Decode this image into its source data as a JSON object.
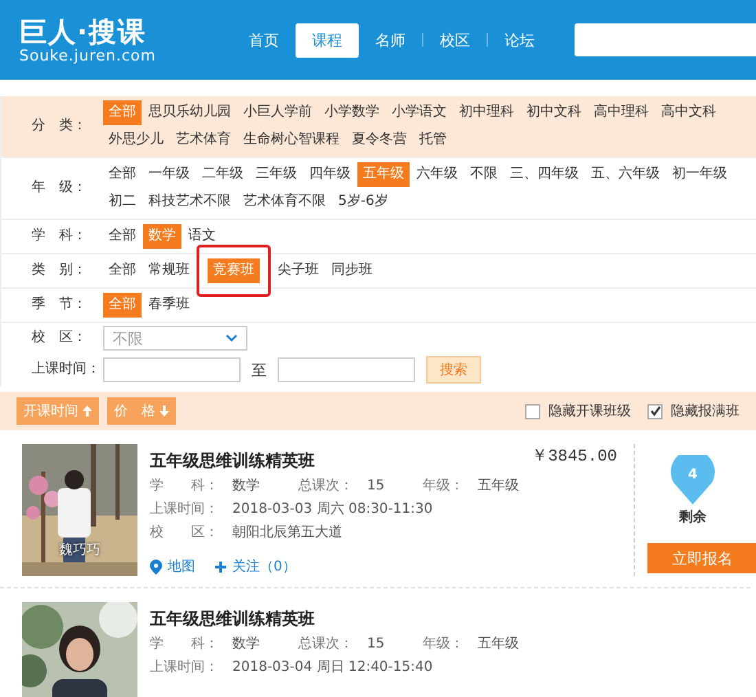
{
  "header": {
    "logo": "巨人·搜课",
    "domain": "Souke.juren.com",
    "nav": [
      {
        "label": "首页",
        "selected": false
      },
      {
        "label": "课程",
        "selected": true
      },
      {
        "label": "名师",
        "selected": false
      },
      {
        "label": "校区",
        "selected": false
      },
      {
        "label": "论坛",
        "selected": false
      }
    ]
  },
  "filters": [
    {
      "label": "分　类：",
      "shaded": true,
      "options": [
        {
          "label": "全部",
          "selected": true
        },
        {
          "label": "思贝乐幼儿园",
          "selected": false
        },
        {
          "label": "小巨人学前",
          "selected": false
        },
        {
          "label": "小学数学",
          "selected": false
        },
        {
          "label": "小学语文",
          "selected": false
        },
        {
          "label": "初中理科",
          "selected": false
        },
        {
          "label": "初中文科",
          "selected": false
        },
        {
          "label": "高中理科",
          "selected": false
        },
        {
          "label": "高中文科",
          "selected": false
        },
        {
          "label": "外思少儿",
          "selected": false
        },
        {
          "label": "艺术体育",
          "selected": false
        },
        {
          "label": "生命树心智课程",
          "selected": false
        },
        {
          "label": "夏令冬营",
          "selected": false
        },
        {
          "label": "托管",
          "selected": false
        }
      ]
    },
    {
      "label": "年　级：",
      "shaded": false,
      "options": [
        {
          "label": "全部",
          "selected": false
        },
        {
          "label": "一年级",
          "selected": false
        },
        {
          "label": "二年级",
          "selected": false
        },
        {
          "label": "三年级",
          "selected": false
        },
        {
          "label": "四年级",
          "selected": false
        },
        {
          "label": "五年级",
          "selected": true
        },
        {
          "label": "六年级",
          "selected": false
        },
        {
          "label": "不限",
          "selected": false
        },
        {
          "label": "三、四年级",
          "selected": false
        },
        {
          "label": "五、六年级",
          "selected": false
        },
        {
          "label": "初一年级",
          "selected": false
        },
        {
          "label": "初二",
          "selected": false
        },
        {
          "label": "科技艺术不限",
          "selected": false
        },
        {
          "label": "艺术体育不限",
          "selected": false
        },
        {
          "label": "5岁-6岁",
          "selected": false
        }
      ]
    },
    {
      "label": "学　科：",
      "shaded": false,
      "options": [
        {
          "label": "全部",
          "selected": false
        },
        {
          "label": "数学",
          "selected": true
        },
        {
          "label": "语文",
          "selected": false
        }
      ]
    },
    {
      "label": "类　别：",
      "shaded": false,
      "options": [
        {
          "label": "全部",
          "selected": false
        },
        {
          "label": "常规班",
          "selected": false
        },
        {
          "label": "竞赛班",
          "selected": true,
          "marked": true
        },
        {
          "label": "尖子班",
          "selected": false
        },
        {
          "label": "同步班",
          "selected": false
        }
      ]
    },
    {
      "label": "季　节：",
      "shaded": false,
      "options": [
        {
          "label": "全部",
          "selected": true
        },
        {
          "label": "春季班",
          "selected": false
        }
      ]
    }
  ],
  "campus": {
    "label": "校　区：",
    "placeholder": "不限"
  },
  "time": {
    "label": "上课时间：",
    "separator": "至",
    "button": "搜索"
  },
  "sort": [
    {
      "label": "开课时间",
      "ascending": true
    },
    {
      "label": "价　格",
      "ascending": false
    }
  ],
  "toggles": [
    {
      "label": "隐藏开课班级",
      "checked": false
    },
    {
      "label": "隐藏报满班",
      "checked": true
    }
  ],
  "courses": [
    {
      "teacher": "魏巧巧",
      "title": "五年级思维训练精英班",
      "price": "￥3845.00",
      "fields": [
        {
          "label": "学　　科：",
          "value": "数学"
        },
        {
          "label": "总课次：",
          "value": "15"
        },
        {
          "label": "年级：",
          "value": "五年级"
        }
      ],
      "rows": [
        {
          "label": "上课时间：",
          "value": "2018-03-03  周六  08:30-11:30"
        },
        {
          "label": "校　　区：",
          "value": "朝阳北辰第五大道"
        }
      ],
      "links": [
        {
          "kind": "map",
          "label": "地图"
        },
        {
          "kind": "follow",
          "label": "关注（0）"
        }
      ],
      "remaining": "4",
      "remaining_label": "剩余",
      "button": "立即报名"
    },
    {
      "title": "五年级思维训练精英班",
      "fields": [
        {
          "label": "学　　科：",
          "value": "数学"
        },
        {
          "label": "总课次：",
          "value": "15"
        },
        {
          "label": "年级：",
          "value": "五年级"
        }
      ],
      "rows": [
        {
          "label": "上课时间：",
          "value": "2018-03-04  周日  12:40-15:40"
        }
      ]
    }
  ]
}
